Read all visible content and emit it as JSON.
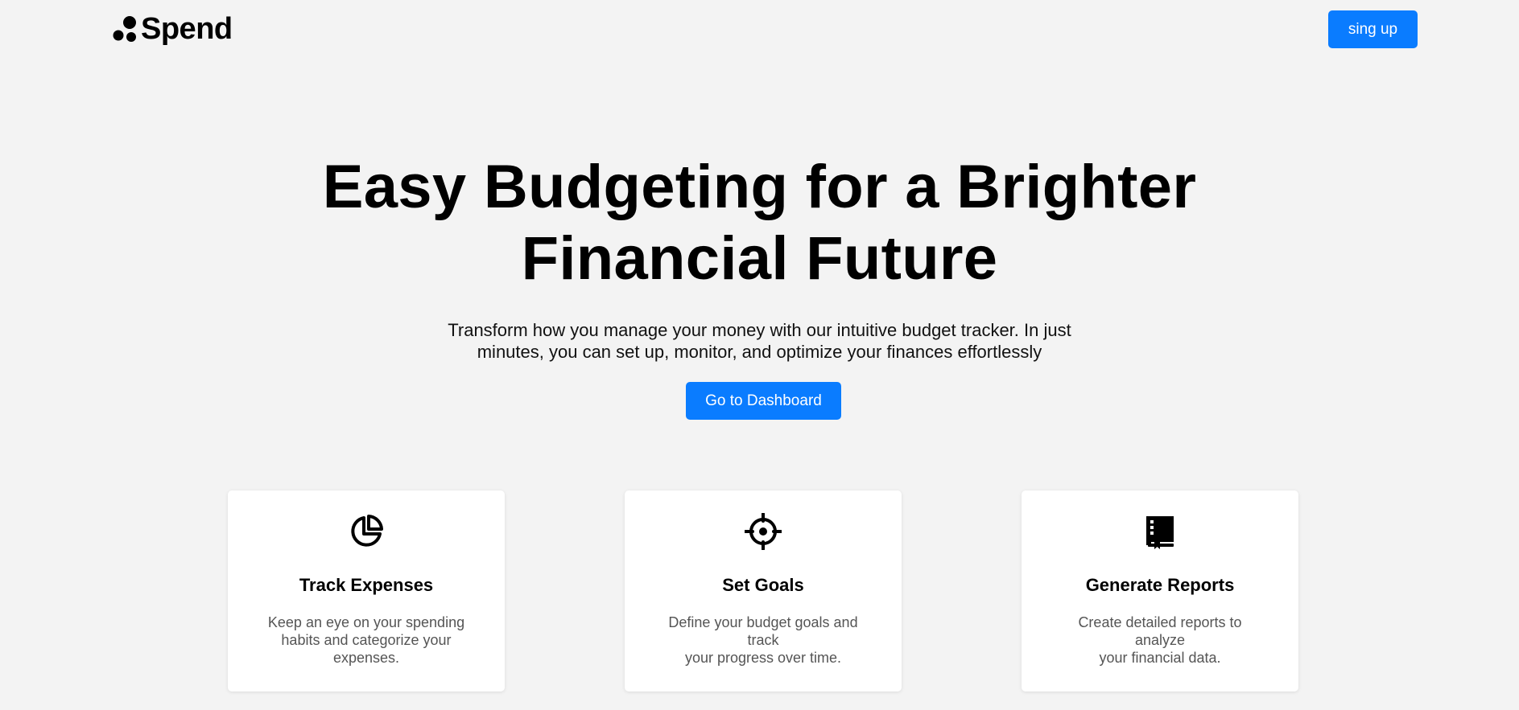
{
  "header": {
    "brand": "Spend",
    "signup_label": "sing up"
  },
  "hero": {
    "title_line1": "Easy Budgeting for a Brighter",
    "title_line2": "Financial Future",
    "subtitle_line1": "Transform how you manage your money with our intuitive budget tracker. In just",
    "subtitle_line2": "minutes, you can set up, monitor, and optimize your finances effortlessly",
    "cta_label": "Go to Dashboard"
  },
  "features": [
    {
      "icon": "pie-chart-icon",
      "title": "Track Expenses",
      "desc_lines": [
        "Keep an eye on your spending",
        "habits and categorize your",
        "expenses."
      ]
    },
    {
      "icon": "crosshair-target-icon",
      "title": "Set Goals",
      "desc_lines": [
        "Define your budget goals and track",
        "your progress over time."
      ]
    },
    {
      "icon": "book-report-icon",
      "title": "Generate Reports",
      "desc_lines": [
        "Create detailed reports to analyze",
        "your financial data."
      ]
    }
  ],
  "colors": {
    "background": "#f3f3f3",
    "accent": "#0a7cff",
    "card": "#ffffff",
    "muted_text": "#555555"
  }
}
